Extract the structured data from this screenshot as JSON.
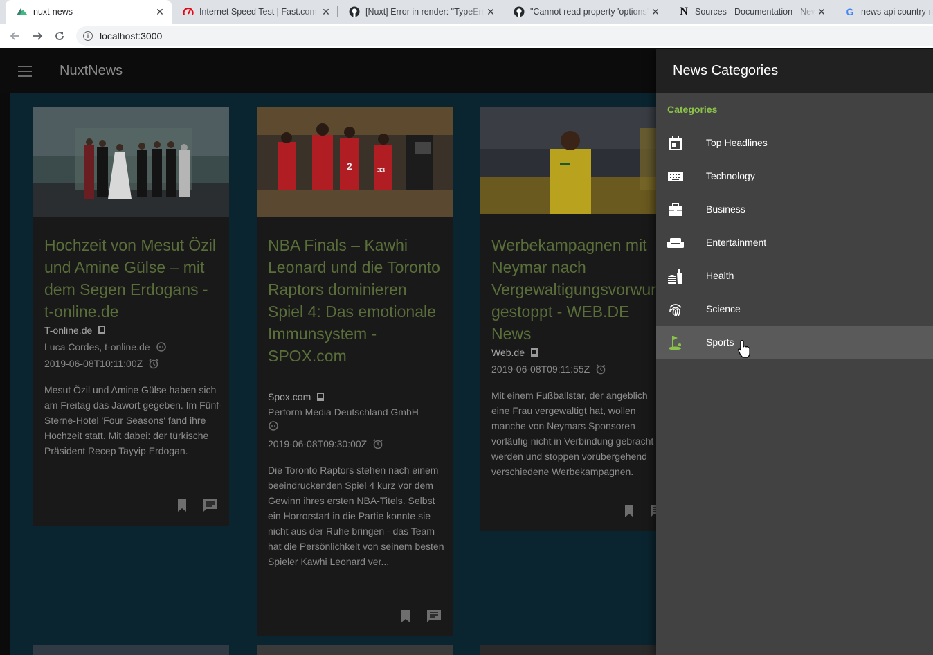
{
  "browser": {
    "tabs": [
      {
        "title": "nuxt-news",
        "favicon": "nuxt-icon",
        "active": true
      },
      {
        "title": "Internet Speed Test | Fast.com",
        "favicon": "fast-icon",
        "active": false
      },
      {
        "title": "[Nuxt] Error in render: \"TypeError",
        "favicon": "github-icon",
        "active": false
      },
      {
        "title": "\"Cannot read property 'options' o",
        "favicon": "github-icon",
        "active": false
      },
      {
        "title": "Sources - Documentation - News",
        "favicon": "newsapi-icon",
        "active": false
      },
      {
        "title": "news api country nar",
        "favicon": "google-icon",
        "active": false
      }
    ],
    "url": "localhost:3000"
  },
  "app": {
    "brand": "NuxtNews"
  },
  "articles": [
    {
      "title": "Hochzeit von Mesut Özil und Amine Gülse – mit dem Segen Erdogans - t-online.de",
      "source": "T-online.de",
      "author": "Luca Cordes, t-online.de",
      "published": "2019-06-08T10:11:00Z",
      "description": "Mesut Özil und Amine Gülse haben sich am Freitag das Jawort gegeben. Im Fünf-Sterne-Hotel 'Four Seasons' fand ihre Hochzeit statt. Mit dabei: der türkische Präsident Recep Tayyip Erdogan."
    },
    {
      "title": "NBA Finals – Kawhi Leonard und die Toronto Raptors dominieren Spiel 4: Das emotionale Immunsystem - SPOX.com",
      "source": "Spox.com",
      "author": "Perform Media Deutschland GmbH",
      "published": "2019-06-08T09:30:00Z",
      "description": "Die Toronto Raptors stehen nach einem beeindruckenden Spiel 4 kurz vor dem Gewinn ihres ersten NBA-Titels. Selbst ein Horrorstart in die Partie konnte sie nicht aus der Ruhe bringen - das Team hat die Persönlichkeit von seinem besten Spieler Kawhi Leonard ver..."
    },
    {
      "title": "Werbekampagnen mit Neymar nach Vergewaltigungsvorwurf gestoppt - WEB.DE News",
      "source": "Web.de",
      "published": "2019-06-08T09:11:55Z",
      "description": "Mit einem Fußballstar, der angeblich eine Frau vergewaltigt hat, wollen manche von Neymars Sponsoren vorläufig nicht in Verbindung gebracht werden und stoppen vorübergehend verschiedene Werbekampagnen."
    }
  ],
  "drawer": {
    "title": "News Categories",
    "subheader": "Categories",
    "items": [
      {
        "label": "Top Headlines",
        "icon": "calendar-icon"
      },
      {
        "label": "Technology",
        "icon": "keyboard-icon"
      },
      {
        "label": "Business",
        "icon": "briefcase-icon"
      },
      {
        "label": "Entertainment",
        "icon": "sofa-icon"
      },
      {
        "label": "Health",
        "icon": "food-icon"
      },
      {
        "label": "Science",
        "icon": "fingerprint-icon"
      },
      {
        "label": "Sports",
        "icon": "golf-icon",
        "hovered": true
      }
    ]
  },
  "colors": {
    "accent": "#8bc34a",
    "title_green": "#5a6e3a",
    "drawer_bg": "#424242",
    "drawer_header": "#212121",
    "content_bg": "#0b2530"
  }
}
